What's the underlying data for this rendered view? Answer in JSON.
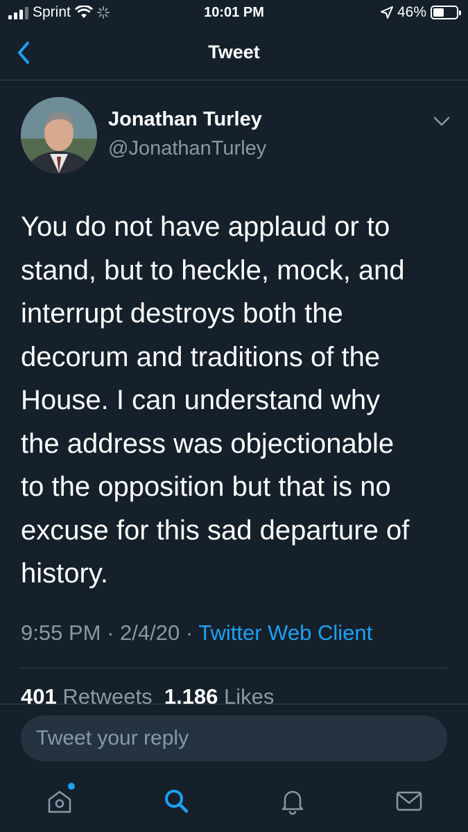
{
  "status_bar": {
    "carrier": "Sprint",
    "time": "10:01 PM",
    "battery_percent": "46%",
    "battery_level": 0.46,
    "icons": [
      "signal-icon",
      "wifi-icon",
      "activity-icon",
      "location-arrow-icon",
      "battery-icon"
    ]
  },
  "header": {
    "title": "Tweet",
    "back_icon": "chevron-left-icon"
  },
  "tweet": {
    "author": {
      "name": "Jonathan Turley",
      "handle": "@JonathanTurley"
    },
    "text": "You do not have applaud or to\nstand, but to heckle, mock, and\ninterrupt destroys both the\ndecorum and traditions of the\nHouse.  I can understand why\nthe address was objectionable\nto the opposition but that is no\nexcuse for this sad departure of\nhistory.",
    "time": "9:55 PM",
    "date": "2/4/20",
    "separator": "·",
    "source": "Twitter Web Client",
    "retweets_count": "401",
    "retweets_label": "Retweets",
    "likes_count": "1,186",
    "likes_label": "Likes"
  },
  "reply": {
    "placeholder": "Tweet your reply"
  },
  "tab_bar": {
    "items": [
      "home-icon",
      "search-icon",
      "notifications-icon",
      "messages-icon"
    ]
  },
  "colors": {
    "background": "#15202b",
    "accent": "#1da1f2",
    "secondary_text": "#8899a6",
    "divider": "#38444d"
  }
}
